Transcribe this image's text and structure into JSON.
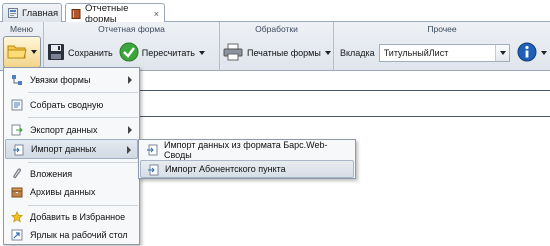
{
  "tabs": [
    {
      "label": "Главная"
    },
    {
      "label": "Отчетные формы",
      "close": "×"
    }
  ],
  "ribbon": {
    "menu_group": {
      "title": "Меню"
    },
    "reports_group": {
      "title": "Отчетная форма",
      "save_label": "Сохранить",
      "recalc_label": "Пересчитать"
    },
    "processing_group": {
      "title": "Обработки",
      "print_label": "Печатные формы"
    },
    "other_group": {
      "title": "Прочее",
      "tab_label": "Вкладка",
      "tab_value": "ТитульныйЛист"
    }
  },
  "menu": {
    "items": [
      {
        "label": "Увязки формы",
        "icon": "links-icon",
        "has_submenu": true
      },
      {
        "label": "Собрать сводную",
        "icon": "collect-icon",
        "has_submenu": false
      },
      {
        "label": "Экспорт данных",
        "icon": "export-icon",
        "has_submenu": true
      },
      {
        "label": "Импорт данных",
        "icon": "import-icon",
        "has_submenu": true
      },
      {
        "label": "Вложения",
        "icon": "paperclip-icon",
        "has_submenu": false
      },
      {
        "label": "Архивы данных",
        "icon": "archive-icon",
        "has_submenu": false
      },
      {
        "label": "Добавить в Избранное",
        "icon": "star-icon",
        "has_submenu": false
      },
      {
        "label": "Ярлык на рабочий стол",
        "icon": "shortcut-icon",
        "has_submenu": false
      }
    ]
  },
  "submenu": {
    "items": [
      {
        "label": "Импорт данных из формата Барс.Web-Своды",
        "icon": "import-file-icon"
      },
      {
        "label": "Импорт Абонентского пункта",
        "icon": "import-file-icon"
      }
    ]
  },
  "colors": {
    "ribbon_bg": "#e6ebf1",
    "border": "#99a8bb",
    "highlight": "#d2dae5",
    "info_blue": "#1f5fb8",
    "check_green": "#3da63a"
  }
}
